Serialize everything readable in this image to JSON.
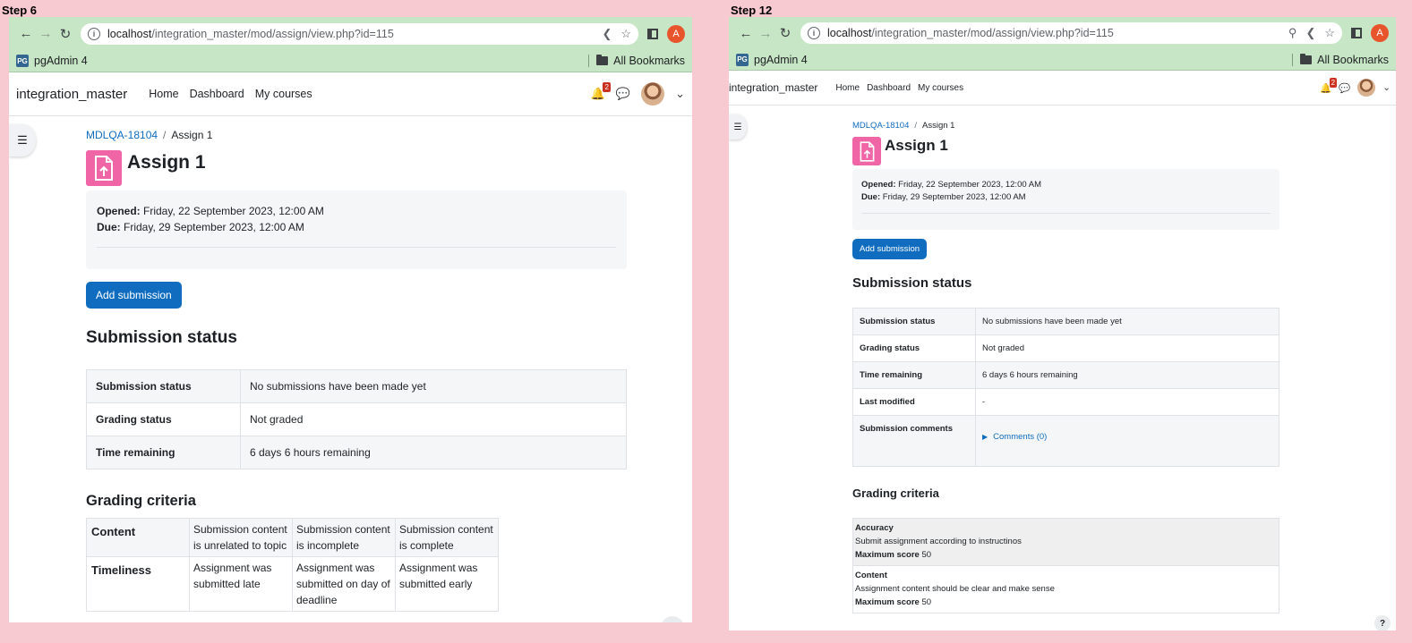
{
  "left": {
    "step_label": "Step 6",
    "browser": {
      "url_host": "localhost",
      "url_path": "/integration_master/mod/assign/view.php?id=115",
      "profile_letter": "A",
      "bookmark_pgadmin": "pgAdmin 4",
      "bookmark_pg_icon": "PG",
      "bookmarks_folder": "All Bookmarks"
    },
    "nav": {
      "site_name": "integration_master",
      "menu": [
        "Home",
        "Dashboard",
        "My courses"
      ],
      "notification_count": "2"
    },
    "breadcrumb": {
      "course": "MDLQA-18104",
      "current": "Assign 1"
    },
    "title": "Assign 1",
    "dates": {
      "opened_label": "Opened:",
      "opened_value": "Friday, 22 September 2023, 12:00 AM",
      "due_label": "Due:",
      "due_value": "Friday, 29 September 2023, 12:00 AM"
    },
    "add_submission_label": "Add submission",
    "submission_status_heading": "Submission status",
    "status_rows": [
      {
        "label": "Submission status",
        "value": "No submissions have been made yet"
      },
      {
        "label": "Grading status",
        "value": "Not graded"
      },
      {
        "label": "Time remaining",
        "value": "6 days 6 hours remaining"
      }
    ],
    "grading_heading": "Grading criteria",
    "rubric": [
      {
        "criterion": "Content",
        "levels": [
          "Submission content is unrelated to topic",
          "Submission content is incomplete",
          "Submission content is complete"
        ]
      },
      {
        "criterion": "Timeliness",
        "levels": [
          "Assignment was submitted late",
          "Assignment was submitted on day of deadline",
          "Assignment was submitted early"
        ]
      }
    ]
  },
  "right": {
    "step_label": "Step 12",
    "browser": {
      "url_host": "localhost",
      "url_path": "/integration_master/mod/assign/view.php?id=115",
      "profile_letter": "A",
      "bookmark_pgadmin": "pgAdmin 4",
      "bookmark_pg_icon": "PG",
      "bookmarks_folder": "All Bookmarks"
    },
    "nav": {
      "site_name": "integration_master",
      "menu": [
        "Home",
        "Dashboard",
        "My courses"
      ],
      "notification_count": "2"
    },
    "breadcrumb": {
      "course": "MDLQA-18104",
      "current": "Assign 1"
    },
    "title": "Assign 1",
    "dates": {
      "opened_label": "Opened:",
      "opened_value": "Friday, 22 September 2023, 12:00 AM",
      "due_label": "Due:",
      "due_value": "Friday, 29 September 2023, 12:00 AM"
    },
    "add_submission_label": "Add submission",
    "submission_status_heading": "Submission status",
    "status_rows": [
      {
        "label": "Submission status",
        "value": "No submissions have been made yet"
      },
      {
        "label": "Grading status",
        "value": "Not graded"
      },
      {
        "label": "Time remaining",
        "value": "6 days 6 hours remaining"
      },
      {
        "label": "Last modified",
        "value": "-"
      },
      {
        "label": "Submission comments",
        "value": "Comments (0)"
      }
    ],
    "grading_heading": "Grading criteria",
    "guide": [
      {
        "name": "Accuracy",
        "description": "Submit assignment according to instructinos",
        "max_label": "Maximum score",
        "max_value": "50"
      },
      {
        "name": "Content",
        "description": "Assignment content should be clear and make sense",
        "max_label": "Maximum score",
        "max_value": "50"
      }
    ],
    "help_label": "?"
  },
  "colors": {
    "page_bg": "#f7c9d1",
    "chrome_green": "#c6e6c6",
    "primary": "#0f6cbf",
    "assign_pink": "#f065a6",
    "badge_red": "#ca3120"
  },
  "icons": [
    "back-icon",
    "forward-icon",
    "reload-icon",
    "info-icon",
    "share-icon",
    "star-icon",
    "zoom-icon",
    "side-panel-icon",
    "folder-icon",
    "bell-icon",
    "chat-icon",
    "drawer-list-icon",
    "assign-upload-icon",
    "help-icon"
  ]
}
